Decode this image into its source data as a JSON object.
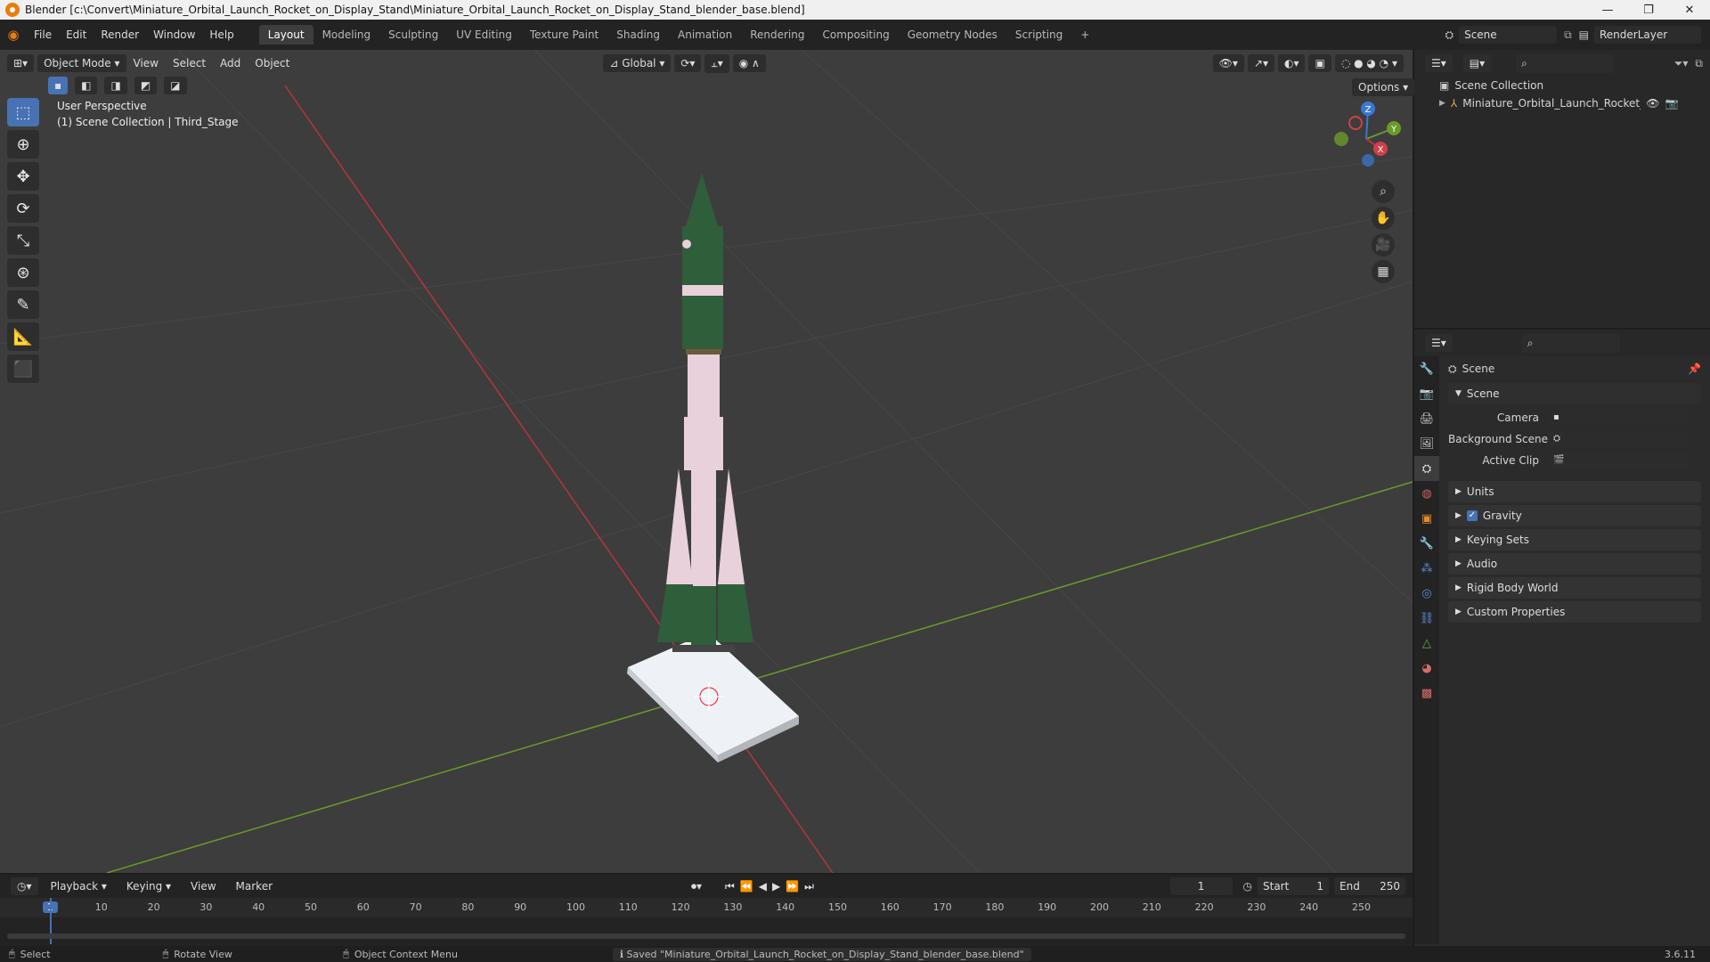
{
  "window": {
    "title": "Blender [c:\\Convert\\Miniature_Orbital_Launch_Rocket_on_Display_Stand\\Miniature_Orbital_Launch_Rocket_on_Display_Stand_blender_base.blend]",
    "minimize": "—",
    "maximize": "❐",
    "close": "✕"
  },
  "menu": [
    "File",
    "Edit",
    "Render",
    "Window",
    "Help"
  ],
  "workspaces": [
    "Layout",
    "Modeling",
    "Sculpting",
    "UV Editing",
    "Texture Paint",
    "Shading",
    "Animation",
    "Rendering",
    "Compositing",
    "Geometry Nodes",
    "Scripting"
  ],
  "add_workspace": "+",
  "scene_field": "Scene",
  "renderlayer_field": "RenderLayer",
  "viewport": {
    "mode": "Object Mode",
    "menus": [
      "View",
      "Select",
      "Add",
      "Object"
    ],
    "transform_orientation": "Global",
    "options": "Options",
    "info_line1": "User Perspective",
    "info_line2": "(1) Scene Collection | Third_Stage",
    "gizmo_labels": {
      "z": "Z",
      "y": "Y",
      "x": "X"
    }
  },
  "outliner": {
    "root": "Scene Collection",
    "item": "Miniature_Orbital_Launch_Rocket_on_D"
  },
  "properties": {
    "header": "Scene",
    "section": "Scene",
    "camera_label": "Camera",
    "background_scene_label": "Background Scene",
    "active_clip_label": "Active Clip",
    "panels": [
      "Units",
      "Gravity",
      "Keying Sets",
      "Audio",
      "Rigid Body World",
      "Custom Properties"
    ],
    "gravity_checked": true
  },
  "timeline": {
    "menus": [
      "Playback",
      "Keying",
      "View",
      "Marker"
    ],
    "current_frame": "1",
    "start_label": "Start",
    "start": "1",
    "end_label": "End",
    "end": "250",
    "ticks": [
      "1",
      "10",
      "20",
      "30",
      "40",
      "50",
      "60",
      "70",
      "80",
      "90",
      "100",
      "110",
      "120",
      "130",
      "140",
      "150",
      "160",
      "170",
      "180",
      "190",
      "200",
      "210",
      "220",
      "230",
      "240",
      "250"
    ]
  },
  "status": {
    "select": "Select",
    "rotate": "Rotate View",
    "context": "Object Context Menu",
    "message": "Saved \"Miniature_Orbital_Launch_Rocket_on_Display_Stand_blender_base.blend\"",
    "version": "3.6.11"
  },
  "colors": {
    "accent": "#4772b3",
    "rocket_green": "#2f5e3a",
    "rocket_pink": "#e8d1db",
    "x_axis": "#b6353d",
    "y_axis": "#6a9b2a"
  }
}
